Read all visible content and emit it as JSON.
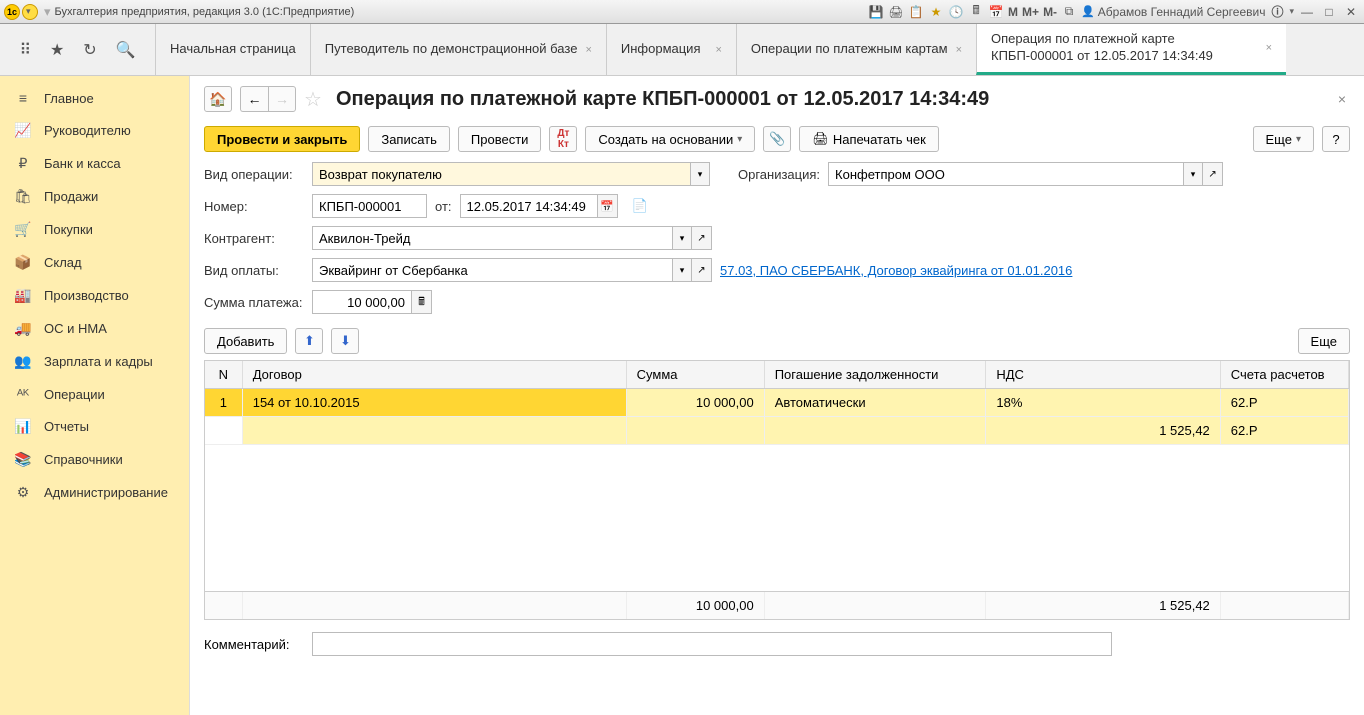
{
  "titlebar": {
    "text": "Бухгалтерия предприятия, редакция 3.0 (1С:Предприятие)",
    "user": "Абрамов Геннадий Сергеевич",
    "m_btns": [
      "M",
      "M+",
      "M-"
    ]
  },
  "tabs": [
    {
      "label": "Начальная страница",
      "closable": false
    },
    {
      "label": "Путеводитель по демонстрационной базе",
      "closable": true
    },
    {
      "label": "Информация",
      "closable": true
    },
    {
      "label": "Операции по платежным картам",
      "closable": true
    },
    {
      "label": "Операция по платежной карте КПБП-000001 от 12.05.2017 14:34:49",
      "closable": true,
      "active": true
    }
  ],
  "sidebar": {
    "items": [
      {
        "icon": "≡",
        "label": "Главное"
      },
      {
        "icon": "📈",
        "label": "Руководителю"
      },
      {
        "icon": "₽",
        "label": "Банк и касса"
      },
      {
        "icon": "🛍",
        "label": "Продажи"
      },
      {
        "icon": "🛒",
        "label": "Покупки"
      },
      {
        "icon": "📦",
        "label": "Склад"
      },
      {
        "icon": "🏭",
        "label": "Производство"
      },
      {
        "icon": "🚚",
        "label": "ОС и НМА"
      },
      {
        "icon": "👥",
        "label": "Зарплата и кадры"
      },
      {
        "icon": "ᴬᴷ",
        "label": "Операции"
      },
      {
        "icon": "📊",
        "label": "Отчеты"
      },
      {
        "icon": "📚",
        "label": "Справочники"
      },
      {
        "icon": "⚙",
        "label": "Администрирование"
      }
    ]
  },
  "page": {
    "title": "Операция по платежной карте КПБП-000001 от 12.05.2017 14:34:49"
  },
  "toolbar": {
    "post_close": "Провести и закрыть",
    "save": "Записать",
    "post": "Провести",
    "create_based": "Создать на основании",
    "print_check": "Напечатать чек",
    "more": "Еще",
    "help": "?"
  },
  "form": {
    "op_type_label": "Вид операции:",
    "op_type_value": "Возврат покупателю",
    "org_label": "Организация:",
    "org_value": "Конфетпром ООО",
    "number_label": "Номер:",
    "number_value": "КПБП-000001",
    "from_label": "от:",
    "date_value": "12.05.2017 14:34:49",
    "counterparty_label": "Контрагент:",
    "counterparty_value": "Аквилон-Трейд",
    "pay_type_label": "Вид оплаты:",
    "pay_type_value": "Эквайринг от Сбербанка",
    "pay_link": "57.03, ПАО СБЕРБАНК, Договор эквайринга от 01.01.2016",
    "amount_label": "Сумма платежа:",
    "amount_value": "10 000,00",
    "add_btn": "Добавить",
    "comment_label": "Комментарий:",
    "comment_value": ""
  },
  "table": {
    "headers": {
      "n": "N",
      "contract": "Договор",
      "sum": "Сумма",
      "pay": "Погашение задолженности",
      "vat": "НДС",
      "acc": "Счета расчетов"
    },
    "rows": [
      {
        "n": "1",
        "contract": "154 от 10.10.2015",
        "sum": "10 000,00",
        "pay": "Автоматически",
        "vat": "18%",
        "acc": "62.Р"
      },
      {
        "n": "",
        "contract": "",
        "sum": "",
        "pay": "",
        "vat": "1 525,42",
        "acc": "62.Р"
      }
    ],
    "footer": {
      "sum": "10 000,00",
      "vat": "1 525,42"
    }
  }
}
